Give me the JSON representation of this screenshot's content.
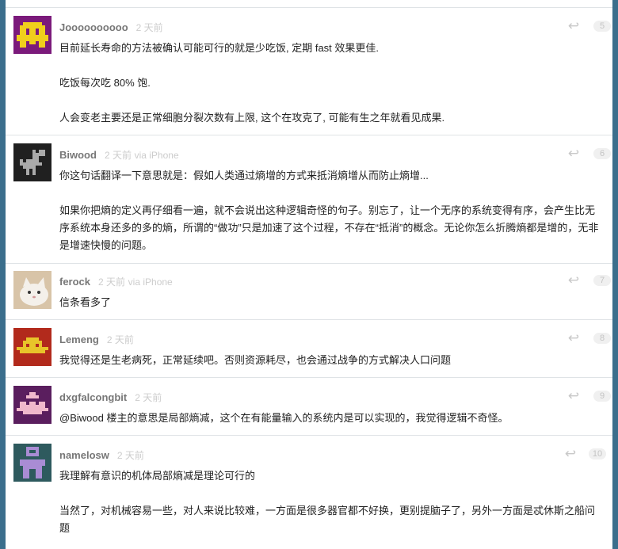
{
  "replies": [
    {
      "username": "Joooooooooo",
      "time": "2 天前",
      "via": "",
      "floor": "5",
      "avatar_icon": "pixel-invader-avatar",
      "avatar_colors": {
        "bg": "#7b1a7b",
        "fg": "#f0cf1c"
      },
      "paragraphs": [
        "目前延长寿命的方法被确认可能可行的就是少吃饭, 定期 fast 效果更佳.",
        "吃饭每次吃 80% 饱.",
        "人会变老主要还是正常细胞分裂次数有上限, 这个在攻克了, 可能有生之年就看见成果."
      ]
    },
    {
      "username": "Biwood",
      "time": "2 天前",
      "via": "via iPhone",
      "floor": "6",
      "avatar_icon": "dinosaur-avatar",
      "avatar_colors": {
        "bg": "#202020",
        "fg": "#aaaaaa"
      },
      "paragraphs": [
        "你这句话翻译一下意思就是：假如人类通过熵增的方式来抵消熵增从而防止熵增...",
        "如果你把熵的定义再仔细看一遍，就不会说出这种逻辑奇怪的句子。别忘了，让一个无序的系统变得有序，会产生比无序系统本身还多的多的熵，所谓的“做功”只是加速了这个过程，不存在“抵消”的概念。无论你怎么折腾熵都是增的，无非是增速快慢的问题。"
      ]
    },
    {
      "username": "ferock",
      "time": "2 天前",
      "via": "via iPhone",
      "floor": "7",
      "avatar_icon": "cat-photo-avatar",
      "avatar_colors": {
        "bg": "#d8c4a8",
        "fg": "#f4f0ea"
      },
      "paragraphs": [
        "信条看多了"
      ]
    },
    {
      "username": "Lemeng",
      "time": "2 天前",
      "via": "",
      "floor": "8",
      "avatar_icon": "pixel-hat-avatar",
      "avatar_colors": {
        "bg": "#b22a1c",
        "fg": "#e8c42a"
      },
      "paragraphs": [
        "我觉得还是生老病死，正常延续吧。否则资源耗尽，也会通过战争的方式解决人口问题"
      ]
    },
    {
      "username": "dxgfalcongbit",
      "time": "2 天前",
      "via": "",
      "floor": "9",
      "avatar_icon": "pixel-invader-avatar",
      "avatar_colors": {
        "bg": "#5a1e5e",
        "fg": "#f0b8cc"
      },
      "paragraphs": [
        "@Biwood 楼主的意思是局部熵减，这个在有能量输入的系统内是可以实现的，我觉得逻辑不奇怪。"
      ]
    },
    {
      "username": "namelosw",
      "time": "2 天前",
      "via": "",
      "floor": "10",
      "avatar_icon": "pixel-robot-avatar",
      "avatar_colors": {
        "bg": "#2e5a5e",
        "fg": "#a98cd4"
      },
      "paragraphs": [
        "我理解有意识的机体局部熵减是理论可行的",
        "当然了，对机械容易一些，对人来说比较难，一方面是很多器官都不好换，更别提脑子了，另外一方面是忒休斯之船问题"
      ]
    }
  ]
}
